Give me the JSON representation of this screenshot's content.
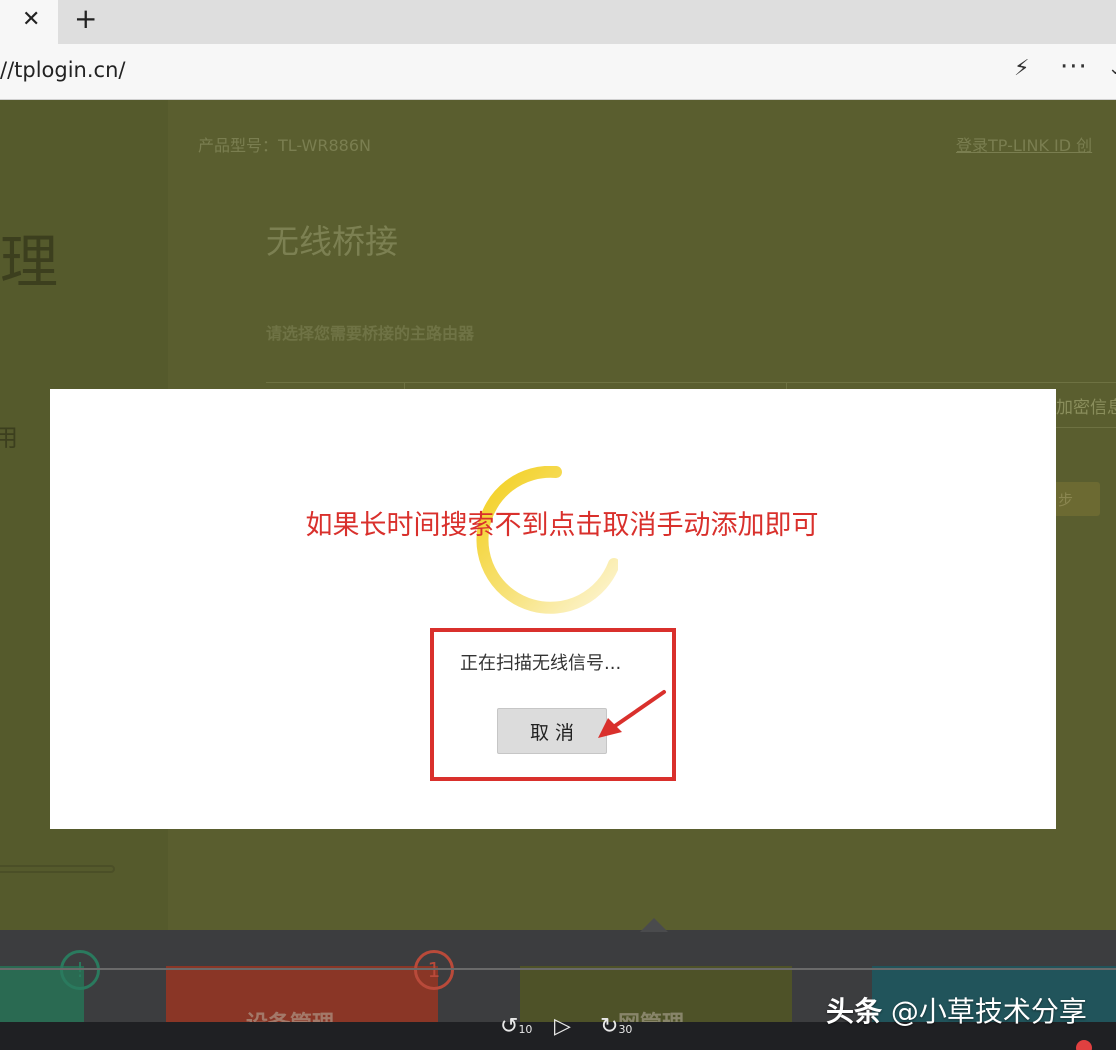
{
  "browser": {
    "tab_close_glyph": "✕",
    "new_tab_glyph": "+",
    "url": "//tplogin.cn/",
    "icons": [
      "close-icon",
      "plus-icon",
      "bolt-icon",
      "more-icon",
      "chevron-down-icon"
    ]
  },
  "header": {
    "model": "产品型号：TL-WR886N",
    "login_link": "登录TP-LINK ID  创"
  },
  "sidebar": {
    "title_fragment": "理",
    "item_fragment": "用"
  },
  "main": {
    "title": "无线桥接",
    "subtitle": "请选择您需要桥接的主路由器",
    "column_encryption": "加密信息",
    "next_button": "步"
  },
  "dialog": {
    "annotation": "如果长时间搜索不到点击取消手动添加即可",
    "status": "正在扫描无线信号...",
    "cancel_label": "取消",
    "spinner_color": "#f5d228",
    "highlight_color": "#d9302c"
  },
  "bottom": {
    "tiles": [
      "设备管理",
      "网管理"
    ],
    "badge_1": "!",
    "badge_2": "1"
  },
  "video": {
    "rewind_label": "10",
    "forward_label": "30",
    "play_glyph": "▷"
  },
  "watermark": {
    "brand": "头条",
    "handle": "@小草技术分享"
  }
}
